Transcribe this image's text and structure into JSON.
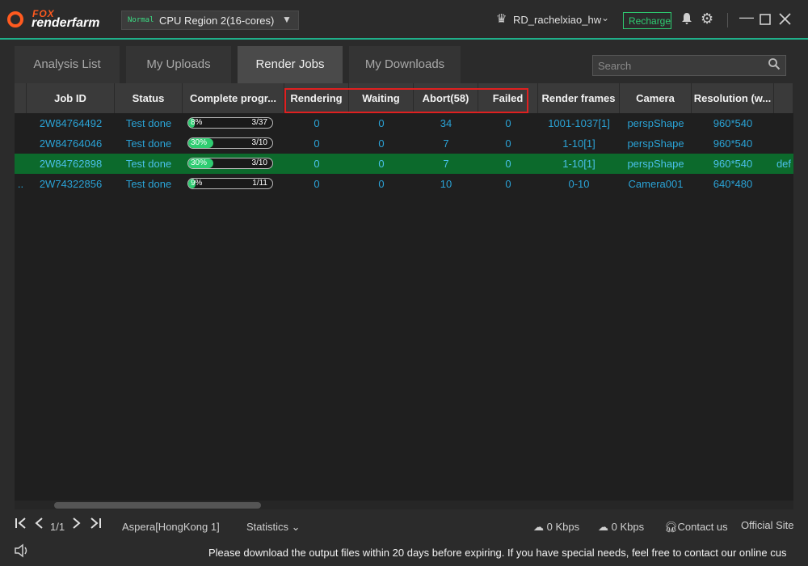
{
  "app": {
    "logo_top": "FOX",
    "logo_bottom": "renderfarm"
  },
  "region": {
    "badge": "Normal",
    "label": "CPU Region 2(16-cores)"
  },
  "user": {
    "name": "RD_rachelxiao_hw",
    "recharge_label": "Recharge"
  },
  "tabs": [
    {
      "label": "Analysis List",
      "active": false
    },
    {
      "label": "My Uploads",
      "active": false
    },
    {
      "label": "Render Jobs",
      "active": true
    },
    {
      "label": "My Downloads",
      "active": false
    }
  ],
  "search": {
    "placeholder": "Search"
  },
  "table": {
    "columns": [
      "Job ID",
      "Status",
      "Complete progr...",
      "Rendering",
      "Waiting",
      "Abort(58)",
      "Failed",
      "Render frames",
      "Camera",
      "Resolution (w..."
    ],
    "rows": [
      {
        "prefix": "",
        "job_id": "2W84764492",
        "status": "Test done",
        "progress_pct": "8%",
        "progress_fraction": 0.08,
        "progress_count": "3/37",
        "rendering": "0",
        "waiting": "0",
        "abort": "34",
        "failed": "0",
        "frames": "1001-1037[1]",
        "camera": "perspShape",
        "resolution": "960*540",
        "extra": "",
        "selected": false
      },
      {
        "prefix": "",
        "job_id": "2W84764046",
        "status": "Test done",
        "progress_pct": "30%",
        "progress_fraction": 0.3,
        "progress_count": "3/10",
        "rendering": "0",
        "waiting": "0",
        "abort": "7",
        "failed": "0",
        "frames": "1-10[1]",
        "camera": "perspShape",
        "resolution": "960*540",
        "extra": "",
        "selected": false
      },
      {
        "prefix": "",
        "job_id": "2W84762898",
        "status": "Test done",
        "progress_pct": "30%",
        "progress_fraction": 0.3,
        "progress_count": "3/10",
        "rendering": "0",
        "waiting": "0",
        "abort": "7",
        "failed": "0",
        "frames": "1-10[1]",
        "camera": "perspShape",
        "resolution": "960*540",
        "extra": "def",
        "selected": true
      },
      {
        "prefix": "..",
        "job_id": "2W74322856",
        "status": "Test done",
        "progress_pct": "9%",
        "progress_fraction": 0.09,
        "progress_count": "1/11",
        "rendering": "0",
        "waiting": "0",
        "abort": "10",
        "failed": "0",
        "frames": "0-10",
        "camera": "Camera001",
        "resolution": "640*480",
        "extra": "",
        "selected": false
      }
    ]
  },
  "footer": {
    "page": "1/1",
    "aspera": "Aspera[HongKong 1]",
    "statistics": "Statistics",
    "upload_speed": "0 Kbps",
    "download_speed": "0 Kbps",
    "contact": "Contact us",
    "official_site": "Official Site",
    "notice": "Please download the output files within 20 days before expiring. If you have special needs, feel free to contact our online cus"
  },
  "colors": {
    "accent": "#1fb08a",
    "link": "#2aa3d6",
    "progress": "#2ecc71",
    "selected_row": "#0c6a2c",
    "highlight": "#e02020",
    "brand": "#ff5a1f"
  }
}
